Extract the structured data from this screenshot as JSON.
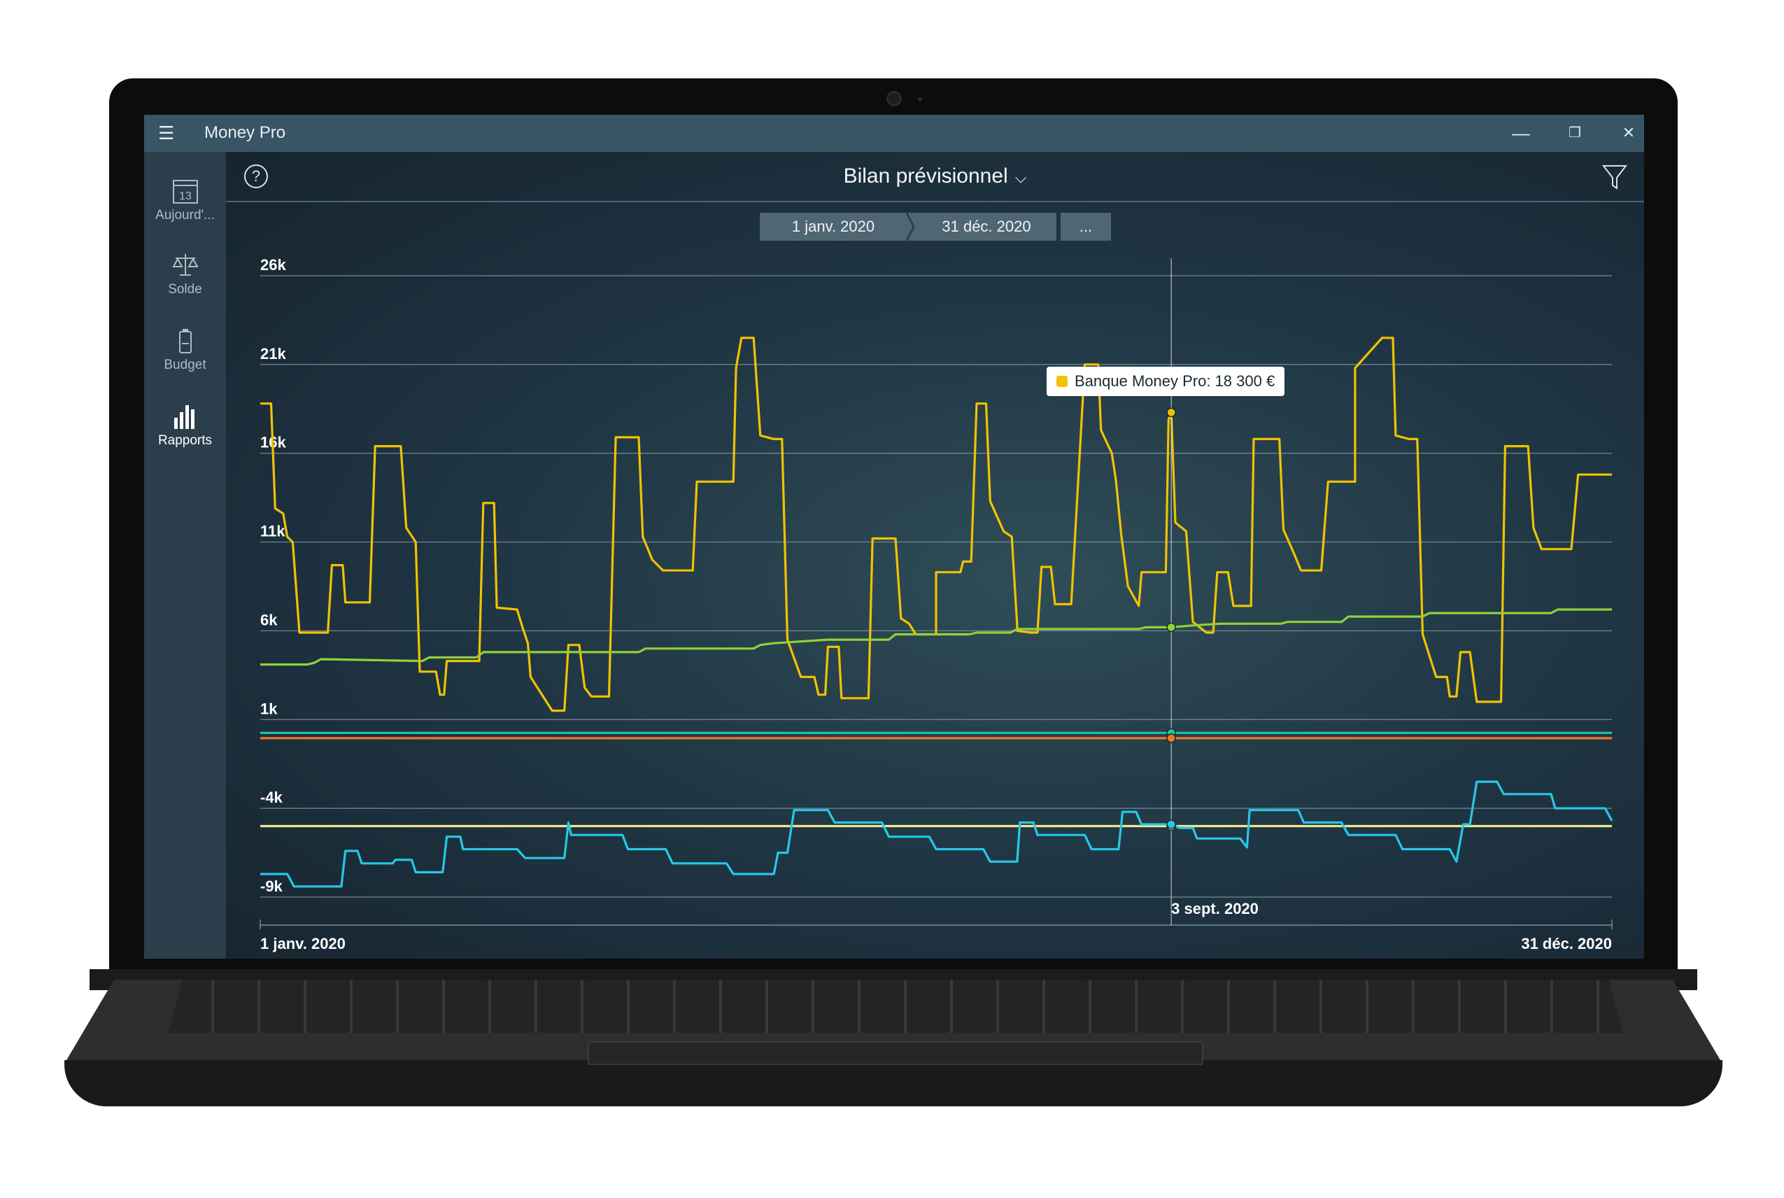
{
  "app": {
    "title": "Money Pro"
  },
  "window_controls": {
    "minimize": "—",
    "restore": "❐",
    "close": "✕"
  },
  "sidebar": {
    "items": [
      {
        "label": "Aujourd'...",
        "icon": "calendar-icon",
        "day": "13"
      },
      {
        "label": "Solde",
        "icon": "balance-scale-icon"
      },
      {
        "label": "Budget",
        "icon": "battery-icon"
      },
      {
        "label": "Rapports",
        "icon": "bar-chart-icon",
        "active": true
      }
    ]
  },
  "header": {
    "title": "Bilan prévisionnel",
    "help": "?"
  },
  "date_range": {
    "start": "1 janv. 2020",
    "end": "31 déc. 2020",
    "more": "..."
  },
  "tooltip": {
    "text": "Banque Money Pro: 18 300 €",
    "color": "#f2c200"
  },
  "cursor_label": "3 sept. 2020",
  "chart_data": {
    "type": "line",
    "x_start": "1 janv. 2020",
    "x_end": "31 déc. 2020",
    "ylim": [
      -9000,
      26000
    ],
    "yticks": [
      {
        "value": 26000,
        "label": "26k"
      },
      {
        "value": 21000,
        "label": "21k"
      },
      {
        "value": 16000,
        "label": "16k"
      },
      {
        "value": 11000,
        "label": "11k"
      },
      {
        "value": 6000,
        "label": "6k"
      },
      {
        "value": 1000,
        "label": "1k"
      },
      {
        "value": -4000,
        "label": "-4k"
      },
      {
        "value": -9000,
        "label": "-9k"
      }
    ],
    "x_labels": [
      "1 janv. 2020",
      "31 déc. 2020"
    ],
    "cursor": {
      "label": "3 sept. 2020",
      "x": 0.674
    },
    "grid": true,
    "series": [
      {
        "name": "Banque Money Pro",
        "color": "#f2c200",
        "points": [
          [
            0,
            18800
          ],
          [
            0.008,
            18800
          ],
          [
            0.01,
            13000
          ],
          [
            0.016,
            12800
          ],
          [
            0.02,
            11300
          ],
          [
            0.024,
            11100
          ],
          [
            0.029,
            5900
          ],
          [
            0.05,
            5900
          ],
          [
            0.053,
            9700
          ],
          [
            0.062,
            9700
          ],
          [
            0.064,
            7600
          ],
          [
            0.08,
            7600
          ],
          [
            0.085,
            16400
          ],
          [
            0.104,
            16400
          ],
          [
            0.109,
            11800
          ],
          [
            0.115,
            10900
          ],
          [
            0.118,
            3800
          ],
          [
            0.12,
            3800
          ],
          [
            0.124,
            3500
          ],
          [
            0.13,
            3500
          ],
          [
            0.133,
            4300
          ],
          [
            0.156,
            4300
          ],
          [
            0.162,
            13200
          ],
          [
            0.17,
            13200
          ],
          [
            0.174,
            7300
          ],
          [
            0.19,
            7200
          ],
          [
            0.194,
            6200
          ],
          [
            0.198,
            6000
          ],
          [
            0.2,
            3400
          ],
          [
            0.22,
            2300
          ],
          [
            0.225,
            2300
          ],
          [
            0.228,
            5200
          ],
          [
            0.236,
            5200
          ],
          [
            0.24,
            2800
          ],
          [
            0.24,
            2800
          ],
          [
            0.245,
            2600
          ],
          [
            0.258,
            2600
          ],
          [
            0.263,
            16900
          ],
          [
            0.28,
            16900
          ],
          [
            0.283,
            11300
          ],
          [
            0.288,
            10000
          ],
          [
            0.298,
            9400
          ],
          [
            0.32,
            9400
          ],
          [
            0.32,
            14400
          ],
          [
            0.33,
            14400
          ],
          [
            0.35,
            14400
          ],
          [
            0.352,
            20700
          ],
          [
            0.36,
            22400
          ],
          [
            0.366,
            22400
          ],
          [
            0.37,
            17000
          ],
          [
            0.38,
            16800
          ],
          [
            0.386,
            16800
          ],
          [
            0.39,
            15500
          ],
          [
            0.4,
            3400
          ],
          [
            0.41,
            3400
          ],
          [
            0.413,
            2400
          ],
          [
            0.418,
            2400
          ],
          [
            0.42,
            5100
          ],
          [
            0.428,
            5100
          ],
          [
            0.43,
            2200
          ],
          [
            0.45,
            2200
          ],
          [
            0.453,
            11200
          ],
          [
            0.47,
            11200
          ],
          [
            0.474,
            6700
          ],
          [
            0.48,
            6400
          ],
          [
            0.49,
            5800
          ],
          [
            0.5,
            5800
          ],
          [
            0.5,
            9300
          ],
          [
            0.518,
            9300
          ],
          [
            0.52,
            9900
          ],
          [
            0.526,
            9900
          ],
          [
            0.53,
            18800
          ],
          [
            0.537,
            18800
          ],
          [
            0.54,
            13200
          ],
          [
            0.544,
            12500
          ],
          [
            0.55,
            11500
          ],
          [
            0.53,
            11500
          ],
          [
            0.556,
            11300
          ],
          [
            0.55,
            11300
          ],
          [
            0.56,
            6200
          ],
          [
            0.57,
            6100
          ],
          [
            0.56,
            6100
          ],
          [
            0.551,
            6000
          ],
          [
            0.552,
            6000
          ],
          [
            0.56,
            6000
          ],
          [
            0.56,
            6000
          ],
          [
            0.551,
            6000
          ],
          [
            0.56,
            6000
          ],
          [
            0.55,
            6000
          ],
          [
            0.56,
            6000
          ],
          [
            0.551,
            6000
          ],
          [
            0.551,
            6000
          ],
          [
            0.551,
            6000
          ],
          [
            0.55,
            6000
          ],
          [
            0.551,
            6000
          ],
          [
            0.551,
            6000
          ],
          [
            0.551,
            6000
          ],
          [
            0.551,
            6000
          ],
          [
            0.551,
            6000
          ],
          [
            0.551,
            6000
          ],
          [
            0.551,
            6000
          ],
          [
            0.551,
            6000
          ],
          [
            0.551,
            6000
          ],
          [
            0.551,
            6000
          ],
          [
            0.551,
            6000
          ],
          [
            0.551,
            6000
          ],
          [
            0.551,
            6000
          ],
          [
            0.551,
            6000
          ],
          [
            0.551,
            6000
          ],
          [
            0.551,
            6000
          ],
          [
            0.551,
            6000
          ],
          [
            0.551,
            6000
          ],
          [
            0.551,
            6000
          ],
          [
            0.551,
            6000
          ],
          [
            0.551,
            6000
          ],
          [
            0.551,
            6000
          ],
          [
            0.551,
            6000
          ],
          [
            0.551,
            6000
          ],
          [
            0.551,
            6000
          ],
          [
            0.551,
            6000
          ],
          [
            0.551,
            6000
          ],
          [
            0.551,
            6000
          ],
          [
            0.551,
            6000
          ],
          [
            0.551,
            6000
          ],
          [
            0.551,
            6000
          ],
          [
            0.551,
            6000
          ]
        ]
      }
    ]
  }
}
